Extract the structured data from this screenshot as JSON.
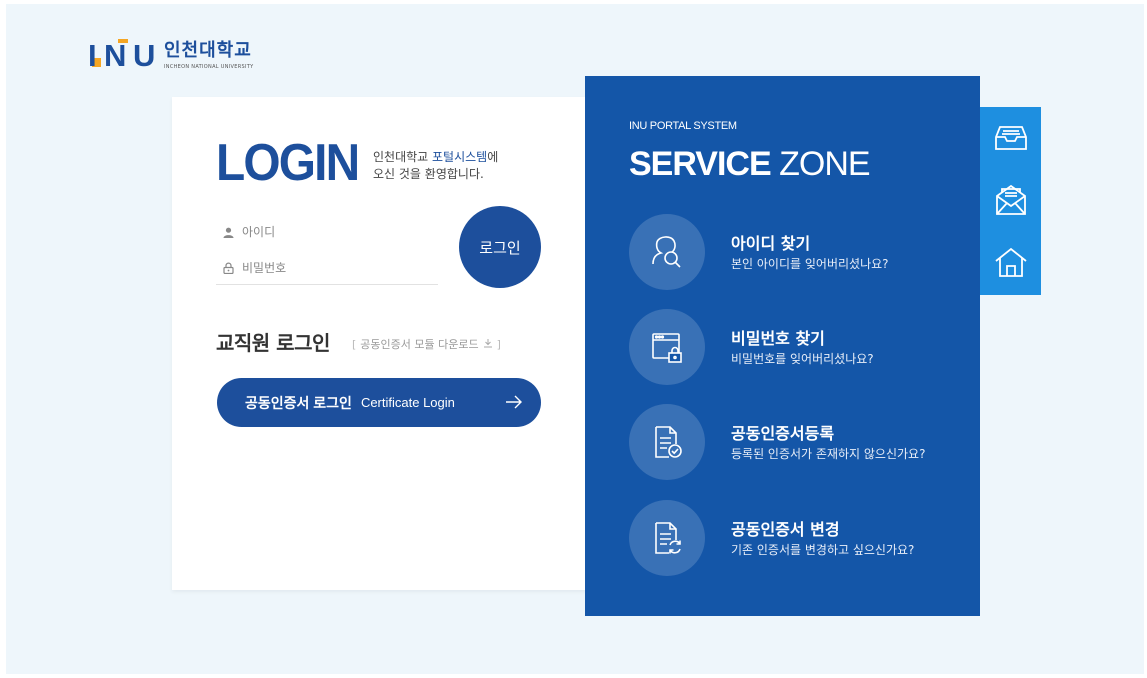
{
  "logo": {
    "mark": [
      "I",
      "N",
      "U"
    ],
    "name_kr": "인천대학교",
    "name_en": "INCHEON NATIONAL UNIVERSITY"
  },
  "login": {
    "title": "LOGIN",
    "welcome_pre": "인천대학교 ",
    "welcome_highlight": "포털시스템",
    "welcome_post": "에",
    "welcome_line2": "오신 것을 환영합니다.",
    "id_placeholder": "아이디",
    "pw_placeholder": "비밀번호",
    "login_button": "로그인",
    "staff_title": "교직원 로그인",
    "cert_download": "공동인증서 모듈 다운로드",
    "cert_button_kr": "공동인증서 로그인",
    "cert_button_en": "Certificate Login"
  },
  "service": {
    "subtitle": "INU PORTAL SYSTEM",
    "title_bold": "SERVICE",
    "title_light": " ZONE",
    "items": [
      {
        "title": "아이디 찾기",
        "desc": "본인 아이디를 잊어버리셨나요?",
        "icon": "find-id-icon"
      },
      {
        "title": "비밀번호 찾기",
        "desc": "비밀번호를 잊어버리셨나요?",
        "icon": "find-password-icon"
      },
      {
        "title": "공동인증서등록",
        "desc": "등록된 인증서가 존재하지 않으신가요?",
        "icon": "certificate-register-icon"
      },
      {
        "title": "공동인증서 변경",
        "desc": "기존 인증서를 변경하고 싶으신가요?",
        "icon": "certificate-change-icon"
      }
    ]
  },
  "sidebar": {
    "icons": [
      "inbox-icon",
      "mail-icon",
      "home-icon"
    ]
  },
  "colors": {
    "primary": "#1d4f9c",
    "service_bg": "#1456a8",
    "sidebar_bg": "#1e8fe0",
    "accent": "#f5a623",
    "page_bg": "#eef6fb"
  }
}
